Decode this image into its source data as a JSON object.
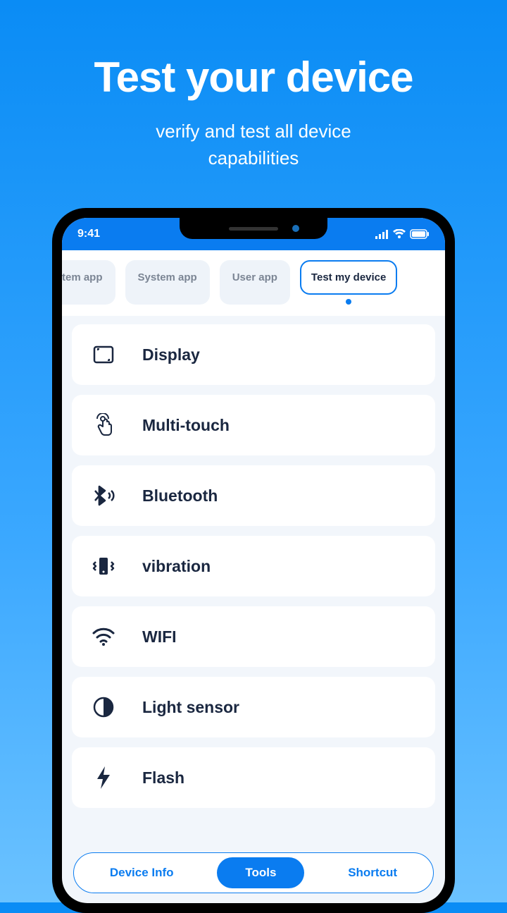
{
  "hero": {
    "title": "Test your device",
    "subtitle_l1": "verify and test all device",
    "subtitle_l2": "capabilities"
  },
  "statusbar": {
    "time": "9:41"
  },
  "tabs": [
    {
      "label": "tem app",
      "active": false
    },
    {
      "label": "System app",
      "active": false
    },
    {
      "label": "User app",
      "active": false
    },
    {
      "label": "Test my device",
      "active": true
    }
  ],
  "tests": [
    {
      "icon": "display",
      "label": "Display"
    },
    {
      "icon": "touch",
      "label": "Multi-touch"
    },
    {
      "icon": "bluetooth",
      "label": "Bluetooth"
    },
    {
      "icon": "vibration",
      "label": "vibration"
    },
    {
      "icon": "wifi",
      "label": "WIFI"
    },
    {
      "icon": "lightsensor",
      "label": "Light sensor"
    },
    {
      "icon": "flash",
      "label": "Flash"
    }
  ],
  "bottom_nav": [
    {
      "label": "Device Info",
      "active": false
    },
    {
      "label": "Tools",
      "active": true
    },
    {
      "label": "Shortcut",
      "active": false
    }
  ]
}
